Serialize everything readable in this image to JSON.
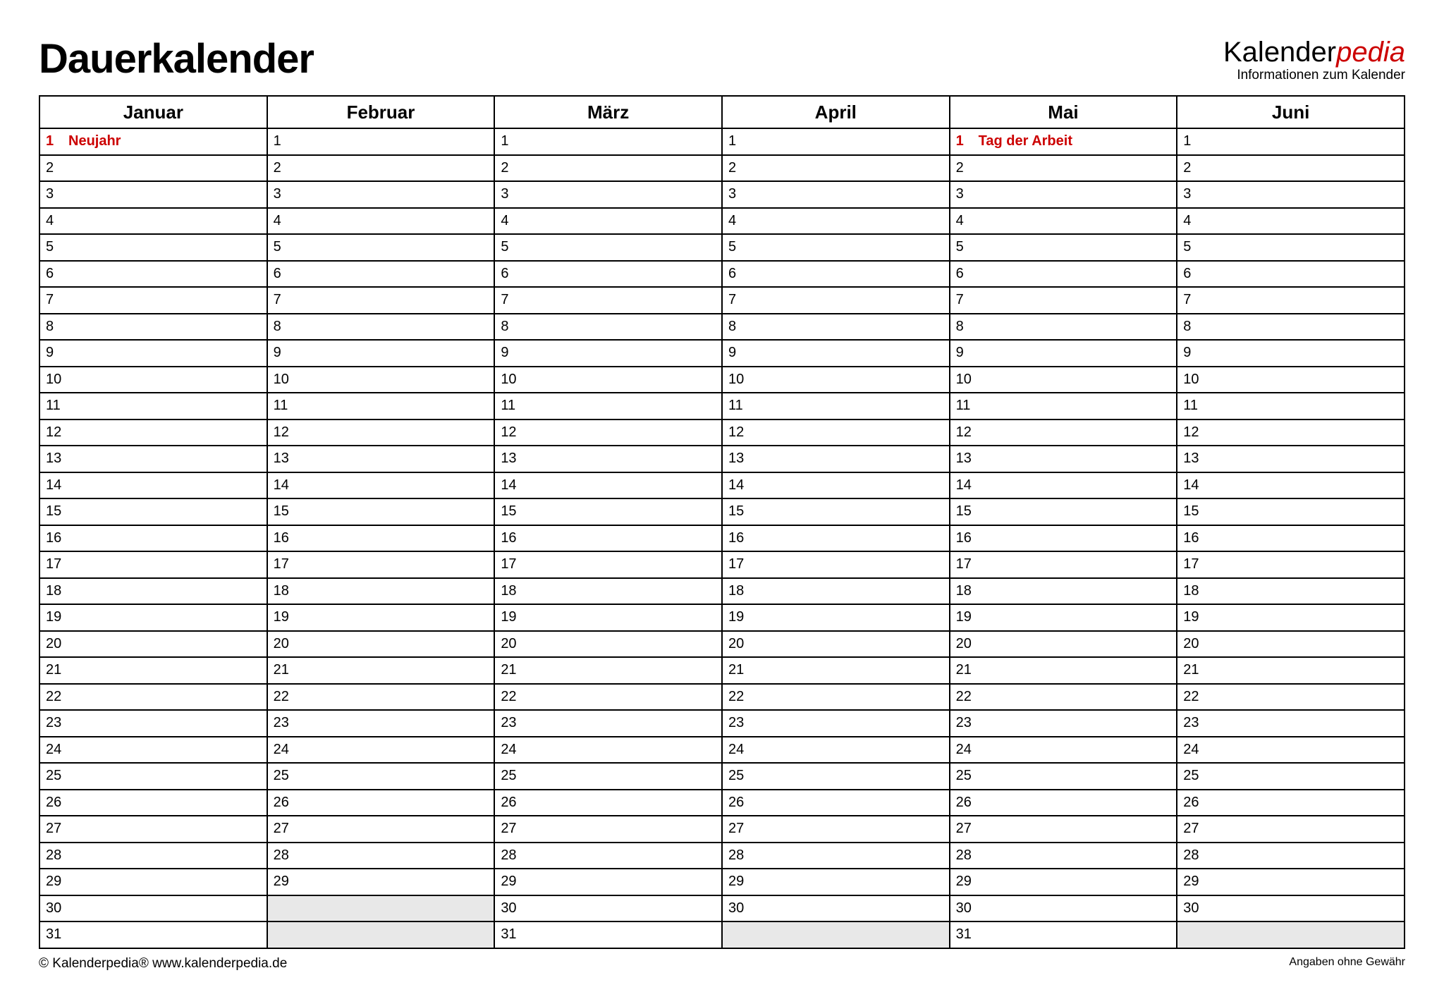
{
  "header": {
    "title": "Dauerkalender",
    "brand_part1": "Kalender",
    "brand_part2": "pedia",
    "brand_sub": "Informationen zum Kalender"
  },
  "months": [
    {
      "name": "Januar",
      "days": 31,
      "holidays": {
        "1": "Neujahr"
      }
    },
    {
      "name": "Februar",
      "days": 29,
      "holidays": {}
    },
    {
      "name": "März",
      "days": 31,
      "holidays": {}
    },
    {
      "name": "April",
      "days": 30,
      "holidays": {}
    },
    {
      "name": "Mai",
      "days": 31,
      "holidays": {
        "1": "Tag der Arbeit"
      }
    },
    {
      "name": "Juni",
      "days": 30,
      "holidays": {}
    }
  ],
  "max_days": 31,
  "footer": {
    "left": "© Kalenderpedia®   www.kalenderpedia.de",
    "right": "Angaben ohne Gewähr"
  }
}
